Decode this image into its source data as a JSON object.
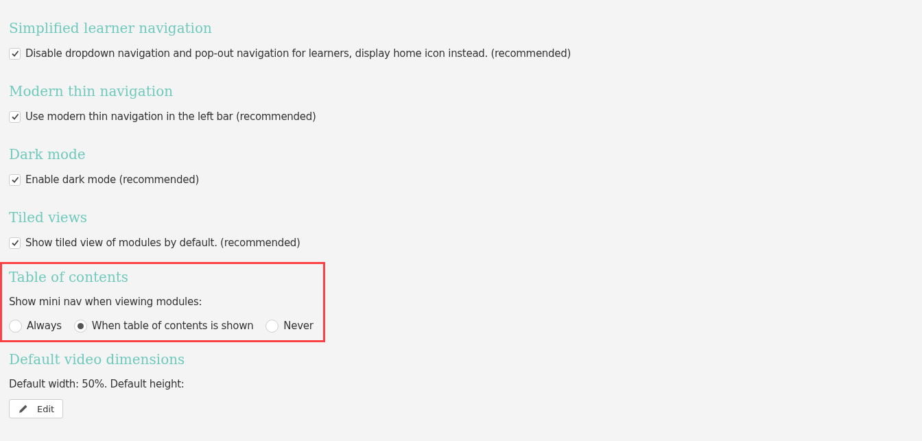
{
  "sections": [
    {
      "kind": "checkbox",
      "title": "Simplified learner navigation",
      "highlighted": false,
      "option": {
        "label": "Disable dropdown navigation and pop-out navigation for learners, display home icon instead. (recommended)",
        "checked": true
      }
    },
    {
      "kind": "checkbox",
      "title": "Modern thin navigation",
      "highlighted": false,
      "option": {
        "label": "Use modern thin navigation in the left bar (recommended)",
        "checked": true
      }
    },
    {
      "kind": "checkbox",
      "title": "Dark mode",
      "highlighted": false,
      "option": {
        "label": "Enable dark mode (recommended)",
        "checked": true
      }
    },
    {
      "kind": "checkbox",
      "title": "Tiled views",
      "highlighted": false,
      "option": {
        "label": "Show tiled view of modules by default. (recommended)",
        "checked": true
      }
    },
    {
      "kind": "radio",
      "title": "Table of contents",
      "highlighted": true,
      "prompt": "Show mini nav when viewing modules:",
      "options": [
        {
          "label": "Always",
          "selected": false
        },
        {
          "label": "When table of contents is shown",
          "selected": true
        },
        {
          "label": "Never",
          "selected": false
        }
      ]
    },
    {
      "kind": "info",
      "title": "Default video dimensions",
      "highlighted": false,
      "text": "Default width: 50%. Default height:",
      "button": "Edit"
    }
  ]
}
